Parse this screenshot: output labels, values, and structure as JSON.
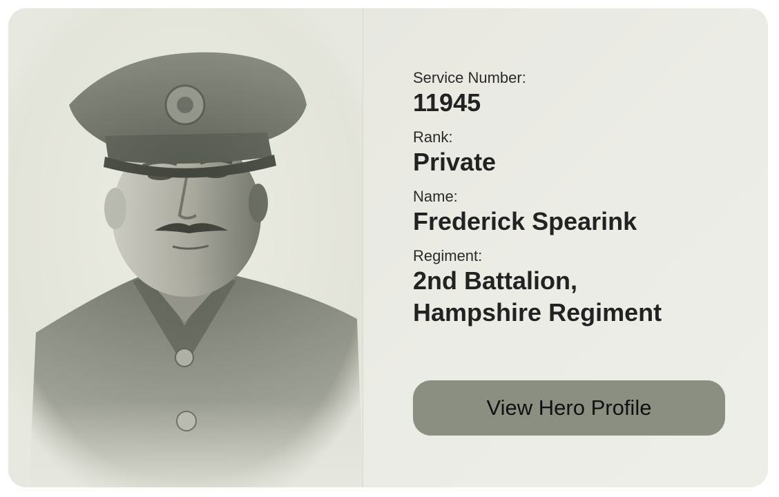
{
  "card": {
    "photo": {
      "subject": "portrait-photo"
    },
    "fields": [
      {
        "label": "Service Number:",
        "value": "11945"
      },
      {
        "label": "Rank:",
        "value": "Private"
      },
      {
        "label": "Name:",
        "value": "Frederick Spearink"
      },
      {
        "label": "Regiment:",
        "value_line1": "2nd Battalion,",
        "value_line2": "Hampshire Regiment"
      }
    ],
    "cta_label": "View Hero Profile"
  },
  "colors": {
    "button": "#8b8f81",
    "card_background": "#e9e9e2",
    "text": "#222222"
  }
}
